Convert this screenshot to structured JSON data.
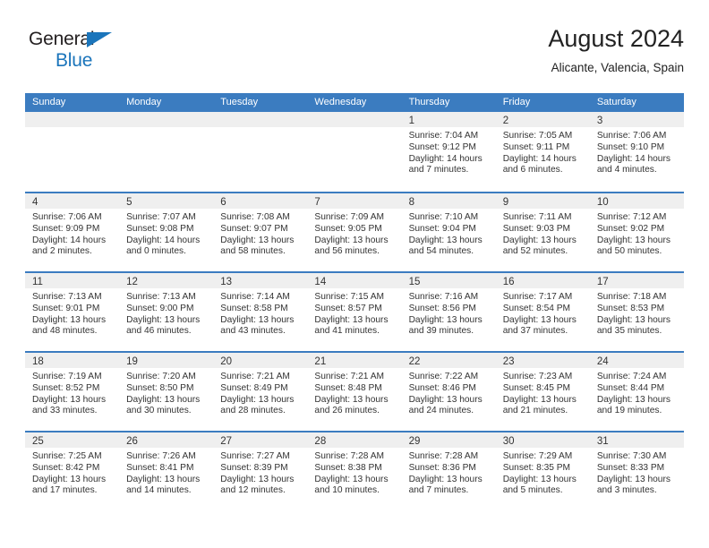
{
  "brand": {
    "line1": "General",
    "line2": "Blue",
    "accent_color": "#1b75bb"
  },
  "header": {
    "title": "August 2024",
    "location": "Alicante, Valencia, Spain"
  },
  "theme": {
    "header_row_bg": "#3b7cc0",
    "header_row_text": "#ffffff",
    "daynum_band_bg": "#efefef",
    "body_text": "#333333"
  },
  "weekdays": [
    "Sunday",
    "Monday",
    "Tuesday",
    "Wednesday",
    "Thursday",
    "Friday",
    "Saturday"
  ],
  "labels": {
    "sunrise_prefix": "Sunrise:",
    "sunset_prefix": "Sunset:",
    "daylight_prefix": "Daylight:"
  },
  "weeks": [
    [
      {
        "day": "",
        "sunrise": "",
        "sunset": "",
        "daylight_l1": "",
        "daylight_l2": ""
      },
      {
        "day": "",
        "sunrise": "",
        "sunset": "",
        "daylight_l1": "",
        "daylight_l2": ""
      },
      {
        "day": "",
        "sunrise": "",
        "sunset": "",
        "daylight_l1": "",
        "daylight_l2": ""
      },
      {
        "day": "",
        "sunrise": "",
        "sunset": "",
        "daylight_l1": "",
        "daylight_l2": ""
      },
      {
        "day": "1",
        "sunrise": "Sunrise: 7:04 AM",
        "sunset": "Sunset: 9:12 PM",
        "daylight_l1": "Daylight: 14 hours",
        "daylight_l2": "and 7 minutes."
      },
      {
        "day": "2",
        "sunrise": "Sunrise: 7:05 AM",
        "sunset": "Sunset: 9:11 PM",
        "daylight_l1": "Daylight: 14 hours",
        "daylight_l2": "and 6 minutes."
      },
      {
        "day": "3",
        "sunrise": "Sunrise: 7:06 AM",
        "sunset": "Sunset: 9:10 PM",
        "daylight_l1": "Daylight: 14 hours",
        "daylight_l2": "and 4 minutes."
      }
    ],
    [
      {
        "day": "4",
        "sunrise": "Sunrise: 7:06 AM",
        "sunset": "Sunset: 9:09 PM",
        "daylight_l1": "Daylight: 14 hours",
        "daylight_l2": "and 2 minutes."
      },
      {
        "day": "5",
        "sunrise": "Sunrise: 7:07 AM",
        "sunset": "Sunset: 9:08 PM",
        "daylight_l1": "Daylight: 14 hours",
        "daylight_l2": "and 0 minutes."
      },
      {
        "day": "6",
        "sunrise": "Sunrise: 7:08 AM",
        "sunset": "Sunset: 9:07 PM",
        "daylight_l1": "Daylight: 13 hours",
        "daylight_l2": "and 58 minutes."
      },
      {
        "day": "7",
        "sunrise": "Sunrise: 7:09 AM",
        "sunset": "Sunset: 9:05 PM",
        "daylight_l1": "Daylight: 13 hours",
        "daylight_l2": "and 56 minutes."
      },
      {
        "day": "8",
        "sunrise": "Sunrise: 7:10 AM",
        "sunset": "Sunset: 9:04 PM",
        "daylight_l1": "Daylight: 13 hours",
        "daylight_l2": "and 54 minutes."
      },
      {
        "day": "9",
        "sunrise": "Sunrise: 7:11 AM",
        "sunset": "Sunset: 9:03 PM",
        "daylight_l1": "Daylight: 13 hours",
        "daylight_l2": "and 52 minutes."
      },
      {
        "day": "10",
        "sunrise": "Sunrise: 7:12 AM",
        "sunset": "Sunset: 9:02 PM",
        "daylight_l1": "Daylight: 13 hours",
        "daylight_l2": "and 50 minutes."
      }
    ],
    [
      {
        "day": "11",
        "sunrise": "Sunrise: 7:13 AM",
        "sunset": "Sunset: 9:01 PM",
        "daylight_l1": "Daylight: 13 hours",
        "daylight_l2": "and 48 minutes."
      },
      {
        "day": "12",
        "sunrise": "Sunrise: 7:13 AM",
        "sunset": "Sunset: 9:00 PM",
        "daylight_l1": "Daylight: 13 hours",
        "daylight_l2": "and 46 minutes."
      },
      {
        "day": "13",
        "sunrise": "Sunrise: 7:14 AM",
        "sunset": "Sunset: 8:58 PM",
        "daylight_l1": "Daylight: 13 hours",
        "daylight_l2": "and 43 minutes."
      },
      {
        "day": "14",
        "sunrise": "Sunrise: 7:15 AM",
        "sunset": "Sunset: 8:57 PM",
        "daylight_l1": "Daylight: 13 hours",
        "daylight_l2": "and 41 minutes."
      },
      {
        "day": "15",
        "sunrise": "Sunrise: 7:16 AM",
        "sunset": "Sunset: 8:56 PM",
        "daylight_l1": "Daylight: 13 hours",
        "daylight_l2": "and 39 minutes."
      },
      {
        "day": "16",
        "sunrise": "Sunrise: 7:17 AM",
        "sunset": "Sunset: 8:54 PM",
        "daylight_l1": "Daylight: 13 hours",
        "daylight_l2": "and 37 minutes."
      },
      {
        "day": "17",
        "sunrise": "Sunrise: 7:18 AM",
        "sunset": "Sunset: 8:53 PM",
        "daylight_l1": "Daylight: 13 hours",
        "daylight_l2": "and 35 minutes."
      }
    ],
    [
      {
        "day": "18",
        "sunrise": "Sunrise: 7:19 AM",
        "sunset": "Sunset: 8:52 PM",
        "daylight_l1": "Daylight: 13 hours",
        "daylight_l2": "and 33 minutes."
      },
      {
        "day": "19",
        "sunrise": "Sunrise: 7:20 AM",
        "sunset": "Sunset: 8:50 PM",
        "daylight_l1": "Daylight: 13 hours",
        "daylight_l2": "and 30 minutes."
      },
      {
        "day": "20",
        "sunrise": "Sunrise: 7:21 AM",
        "sunset": "Sunset: 8:49 PM",
        "daylight_l1": "Daylight: 13 hours",
        "daylight_l2": "and 28 minutes."
      },
      {
        "day": "21",
        "sunrise": "Sunrise: 7:21 AM",
        "sunset": "Sunset: 8:48 PM",
        "daylight_l1": "Daylight: 13 hours",
        "daylight_l2": "and 26 minutes."
      },
      {
        "day": "22",
        "sunrise": "Sunrise: 7:22 AM",
        "sunset": "Sunset: 8:46 PM",
        "daylight_l1": "Daylight: 13 hours",
        "daylight_l2": "and 24 minutes."
      },
      {
        "day": "23",
        "sunrise": "Sunrise: 7:23 AM",
        "sunset": "Sunset: 8:45 PM",
        "daylight_l1": "Daylight: 13 hours",
        "daylight_l2": "and 21 minutes."
      },
      {
        "day": "24",
        "sunrise": "Sunrise: 7:24 AM",
        "sunset": "Sunset: 8:44 PM",
        "daylight_l1": "Daylight: 13 hours",
        "daylight_l2": "and 19 minutes."
      }
    ],
    [
      {
        "day": "25",
        "sunrise": "Sunrise: 7:25 AM",
        "sunset": "Sunset: 8:42 PM",
        "daylight_l1": "Daylight: 13 hours",
        "daylight_l2": "and 17 minutes."
      },
      {
        "day": "26",
        "sunrise": "Sunrise: 7:26 AM",
        "sunset": "Sunset: 8:41 PM",
        "daylight_l1": "Daylight: 13 hours",
        "daylight_l2": "and 14 minutes."
      },
      {
        "day": "27",
        "sunrise": "Sunrise: 7:27 AM",
        "sunset": "Sunset: 8:39 PM",
        "daylight_l1": "Daylight: 13 hours",
        "daylight_l2": "and 12 minutes."
      },
      {
        "day": "28",
        "sunrise": "Sunrise: 7:28 AM",
        "sunset": "Sunset: 8:38 PM",
        "daylight_l1": "Daylight: 13 hours",
        "daylight_l2": "and 10 minutes."
      },
      {
        "day": "29",
        "sunrise": "Sunrise: 7:28 AM",
        "sunset": "Sunset: 8:36 PM",
        "daylight_l1": "Daylight: 13 hours",
        "daylight_l2": "and 7 minutes."
      },
      {
        "day": "30",
        "sunrise": "Sunrise: 7:29 AM",
        "sunset": "Sunset: 8:35 PM",
        "daylight_l1": "Daylight: 13 hours",
        "daylight_l2": "and 5 minutes."
      },
      {
        "day": "31",
        "sunrise": "Sunrise: 7:30 AM",
        "sunset": "Sunset: 8:33 PM",
        "daylight_l1": "Daylight: 13 hours",
        "daylight_l2": "and 3 minutes."
      }
    ]
  ]
}
